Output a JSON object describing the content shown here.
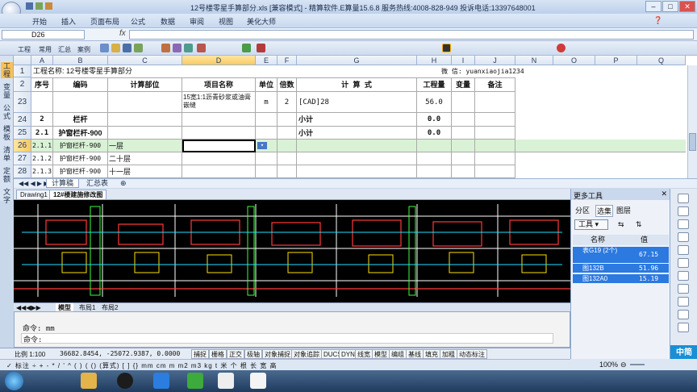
{
  "window": {
    "title": "12号楼零星手算部分.xls  [兼容模式] - 精算软件.E算量15.6.8 服务热线:4008-828-949 投诉电话:13397648001"
  },
  "menu": [
    "开始",
    "插入",
    "页面布局",
    "公式",
    "数据",
    "审阅",
    "视图",
    "美化大师"
  ],
  "formula": {
    "namebox": "D26",
    "fx": "fx"
  },
  "toolbar": {
    "labels": [
      "工程",
      "常用",
      "汇总",
      "案例"
    ]
  },
  "vtabs": [
    "工程",
    "变量",
    "公式",
    "模板",
    "清单",
    "定额",
    "文字"
  ],
  "sheet": {
    "columns": [
      "A",
      "B",
      "C",
      "D",
      "E",
      "F",
      "G",
      "H",
      "I",
      "J",
      "N",
      "O",
      "P",
      "Q"
    ],
    "project_line": "工程名称: 12号楼零星手算部分",
    "wechat": "微 信: yuanxiaojia1234",
    "headers": [
      "序号",
      "编码",
      "计算部位",
      "项目名称",
      "单位",
      "倍数",
      "计 算 式",
      "工程量",
      "变量",
      "备注"
    ],
    "rows": [
      {
        "num": "23",
        "a": "",
        "b": "",
        "c": "",
        "d": "15宽1:1沥青砂浆或油膏嵌缝",
        "e": "m",
        "f": "2",
        "g": "[CAD]28",
        "h": "56.0",
        "sel": false,
        "bold": false
      },
      {
        "num": "24",
        "a": "2",
        "b": "栏杆",
        "c": "",
        "d": "",
        "e": "",
        "f": "",
        "g": "",
        "h": "0.0",
        "sel": false,
        "bold": true
      },
      {
        "num": "25",
        "a": "2.1",
        "b": "护窗栏杆-900",
        "c": "",
        "d": "",
        "e": "",
        "f": "",
        "g": "小计",
        "h": "0.0",
        "sel": false,
        "bold": true
      },
      {
        "num": "26",
        "a": "2.1.1",
        "b": "护窗栏杆-900",
        "c": "一层",
        "d": "",
        "e": "",
        "f": "",
        "g": "",
        "h": "",
        "sel": true,
        "bold": false
      },
      {
        "num": "27",
        "a": "2.1.2",
        "b": "护窗栏杆-900",
        "c": "二十层",
        "d": "",
        "e": "",
        "f": "",
        "g": "",
        "h": "",
        "sel": false,
        "bold": false
      },
      {
        "num": "28",
        "a": "2.1.3",
        "b": "护窗栏杆-900",
        "c": "十一层",
        "d": "",
        "e": "",
        "f": "",
        "g": "",
        "h": "",
        "sel": false,
        "bold": false
      }
    ],
    "row1": "1",
    "row2": "2",
    "xiaoji24": "小计",
    "tabs": [
      "计算稿",
      "汇总表"
    ]
  },
  "doc_tabs": [
    "Drawing1",
    "12#楼建施修改图"
  ],
  "cad_tabs": [
    "模型",
    "布局1",
    "布局2"
  ],
  "command": {
    "line1": "命令: mm",
    "line2": "命令:"
  },
  "status": {
    "scale": "比例 1:100",
    "coords": "36682.8454, -25072.9387, 0.0000",
    "buttons": [
      "捕捉",
      "栅格",
      "正交",
      "极轴",
      "对象捕捉",
      "对象追踪",
      "DUCS",
      "DYN",
      "线宽",
      "模型",
      "编组",
      "基线",
      "填充",
      "加粗",
      "动态标注"
    ]
  },
  "inputbar": "✓ 标注  ÷  +  -  *  /  '  ^  (  )  (  ()  (算式)  [  ]  {}  mm  cm  m  m2  m3  kg  t  米  个  根  长  宽  高",
  "panel": {
    "title": "更多工具",
    "tabs": [
      "分区",
      "选集",
      "图层"
    ],
    "tool_label": "工具 ▾",
    "col_name": "名称",
    "col_value": "值",
    "items": [
      {
        "name": "表G19 (2个)",
        "value": "67.15"
      },
      {
        "name": "图132B",
        "value": "51.96"
      },
      {
        "name": "图132A0",
        "value": "15.19"
      }
    ]
  },
  "zoom": "100%",
  "brand": "中简"
}
